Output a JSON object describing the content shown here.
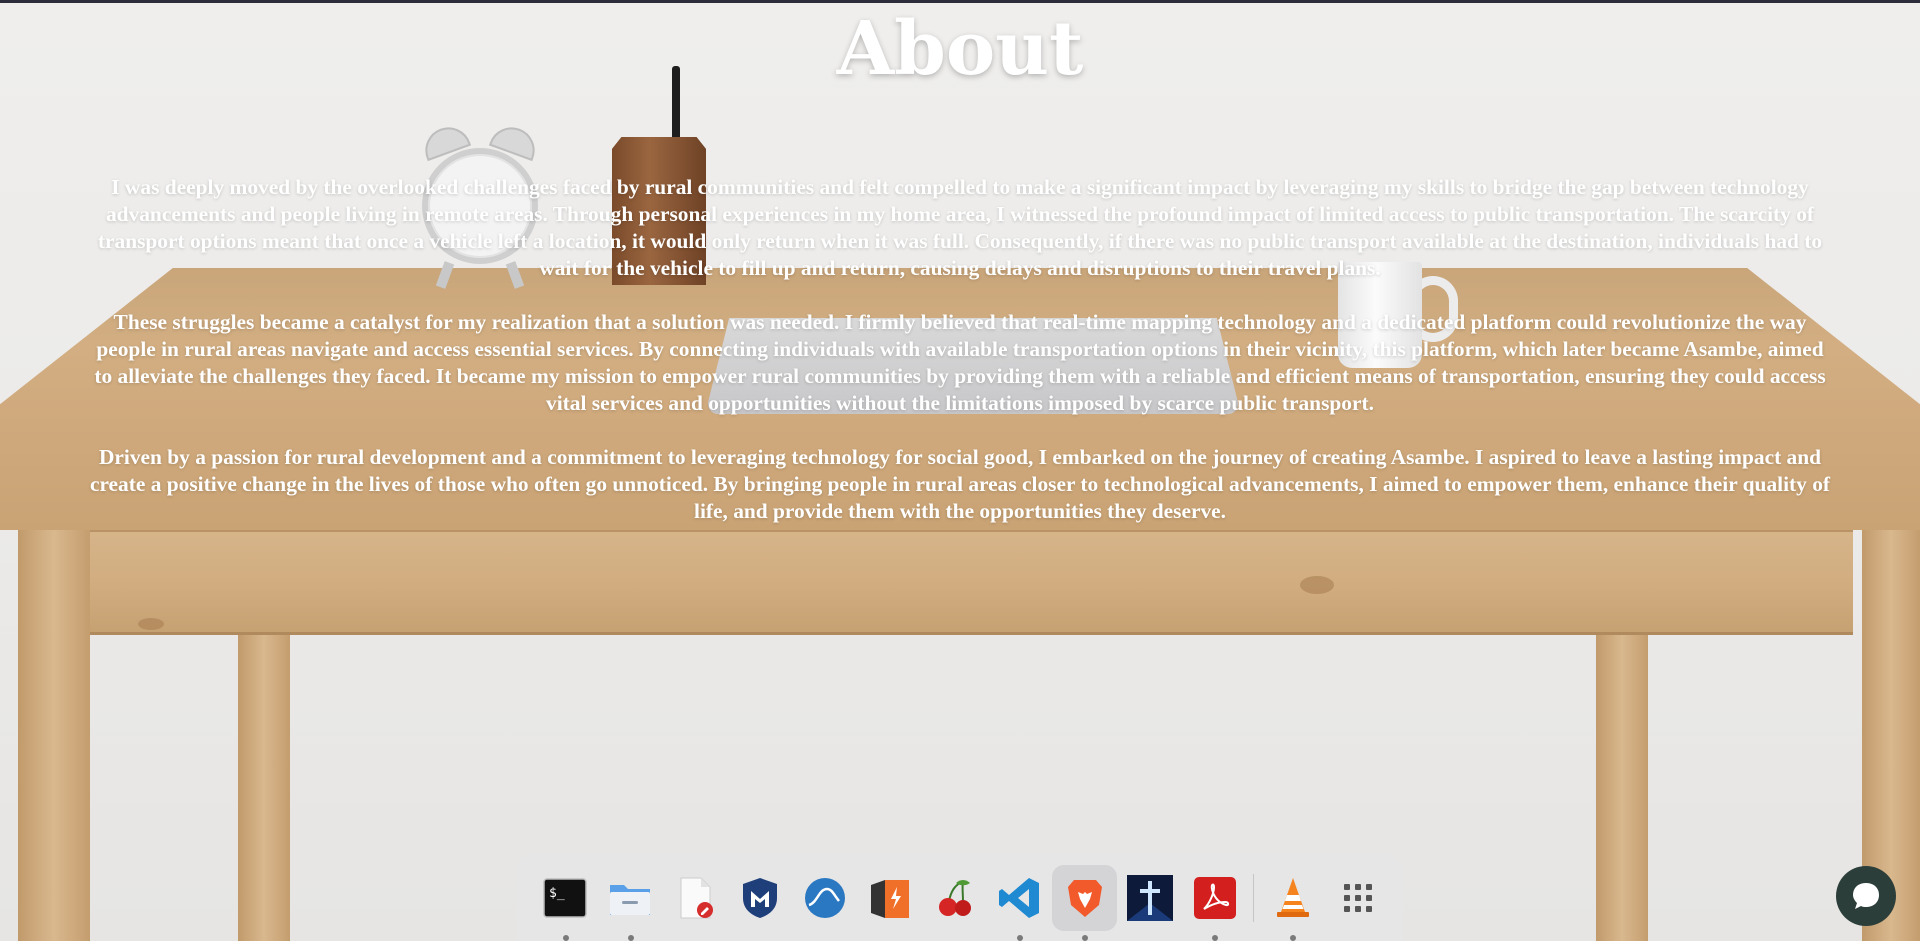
{
  "page": {
    "title": "About",
    "paragraphs": [
      "I was deeply moved by the overlooked challenges faced by rural communities and felt compelled to make a significant impact by leveraging my skills to bridge the gap between technology advancements and people living in remote areas. Through personal experiences in my home area, I witnessed the profound impact of limited access to public transportation. The scarcity of transport options meant that once a vehicle left a location, it would only return when it was full. Consequently, if there was no public transport available at the destination, individuals had to wait for the vehicle to fill up and return, causing delays and disruptions to their travel plans.",
      "These struggles became a catalyst for my realization that a solution was needed. I firmly believed that real-time mapping technology and a dedicated platform could revolutionize the way people in rural areas navigate and access essential services. By connecting individuals with available transportation options in their vicinity, this platform, which later became Asambe, aimed to alleviate the challenges they faced. It became my mission to empower rural communities by providing them with a reliable and efficient means of transportation, ensuring they could access vital services and opportunities without the limitations imposed by scarce public transport.",
      "Driven by a passion for rural development and a commitment to leveraging technology for social good, I embarked on the journey of creating Asambe. I aspired to leave a lasting impact and create a positive change in the lives of those who often go unnoticed. By bringing people in rural areas closer to technological advancements, I aimed to empower them, enhance their quality of life, and provide them with the opportunities they deserve."
    ]
  },
  "dock": {
    "items": [
      {
        "name": "terminal-app",
        "icon": "terminal-icon",
        "running": true,
        "active": false
      },
      {
        "name": "files-app",
        "icon": "folder-icon",
        "running": true,
        "active": false
      },
      {
        "name": "text-editor-app",
        "icon": "text-editor-icon",
        "running": false,
        "active": false
      },
      {
        "name": "metasploit-app",
        "icon": "metasploit-icon",
        "running": false,
        "active": false
      },
      {
        "name": "wireshark-app",
        "icon": "wireshark-icon",
        "running": false,
        "active": false
      },
      {
        "name": "burpsuite-app",
        "icon": "burpsuite-icon",
        "running": false,
        "active": false
      },
      {
        "name": "cherrytree-app",
        "icon": "cherry-icon",
        "running": false,
        "active": false
      },
      {
        "name": "vscode-app",
        "icon": "vscode-icon",
        "running": true,
        "active": false
      },
      {
        "name": "brave-browser-app",
        "icon": "brave-lion-icon",
        "running": true,
        "active": true
      },
      {
        "name": "cross-app",
        "icon": "cross-icon",
        "running": false,
        "active": false
      },
      {
        "name": "pdf-reader-app",
        "icon": "pdf-icon",
        "running": true,
        "active": false
      },
      {
        "name": "vlc-app",
        "icon": "vlc-cone-icon",
        "running": true,
        "active": false
      },
      {
        "name": "app-grid",
        "icon": "app-grid-icon",
        "running": false,
        "active": false
      }
    ]
  },
  "colors": {
    "text": "#ffffff",
    "dock_bg": "#e6e6e8",
    "chat_bg": "#2c3e3a"
  },
  "chat": {
    "icon": "chat-bubble-icon"
  }
}
